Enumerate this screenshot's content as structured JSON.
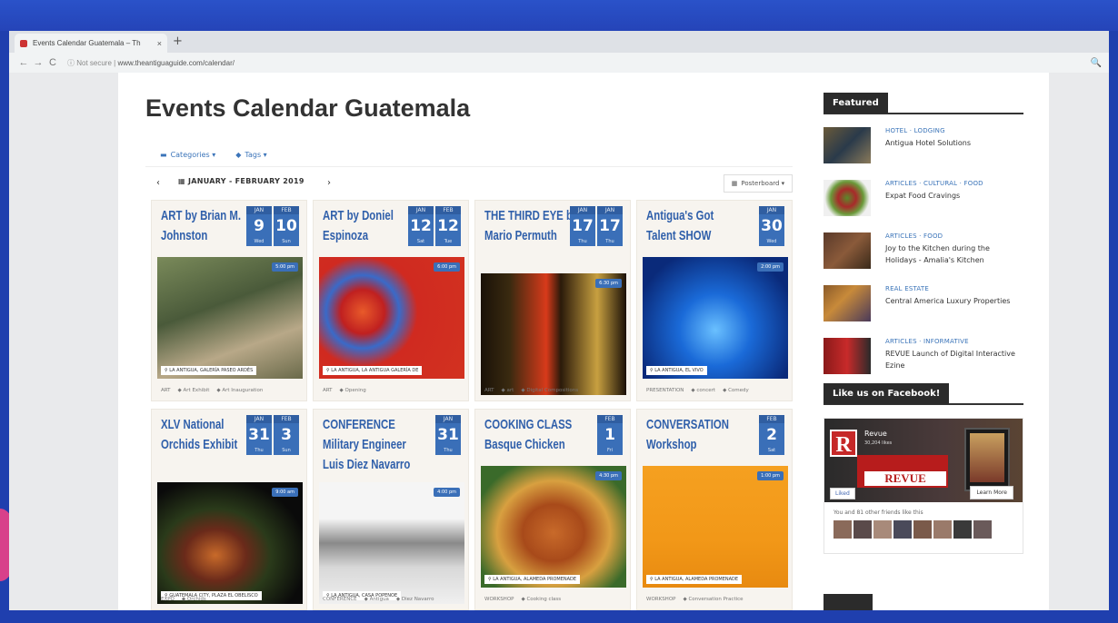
{
  "browser": {
    "tab_title": "Events Calendar Guatemala – Th",
    "tab_close": "×",
    "new_tab": "+",
    "back": "←",
    "forward": "→",
    "reload": "C",
    "security": "ⓘ Not secure",
    "url": "www.theantiguaguide.com/calendar/",
    "zoom": "🔍"
  },
  "page": {
    "title": "Events Calendar Guatemala",
    "filters": {
      "categories": "Categories ▾",
      "tags": "Tags ▾"
    },
    "toolbar": {
      "prev": "‹",
      "next": "›",
      "date_range": "JANUARY - FEBRUARY 2019",
      "layout": "Posterboard ▾"
    }
  },
  "events": [
    {
      "title": "ART by Brian M. Johnston",
      "dates": [
        {
          "month": "JAN",
          "day": "9",
          "weekday": "Wed"
        },
        {
          "month": "FEB",
          "day": "10",
          "weekday": "Sun"
        }
      ],
      "time": "5:00 pm",
      "location": "LA ANTIGUA, GALERÍA PASEO ARDÉS",
      "tags": [
        "ART",
        "Art Exhibit",
        "Art Inauguration"
      ],
      "bg": "linear-gradient(160deg,#7a8a5a,#4a5a3a 40%,#b8a888 70%,#6a6a4a)"
    },
    {
      "title": "ART by Doniel Espinoza",
      "dates": [
        {
          "month": "JAN",
          "day": "12",
          "weekday": "Sat"
        },
        {
          "month": "FEB",
          "day": "12",
          "weekday": "Tue"
        }
      ],
      "time": "6:00 pm",
      "location": "LA ANTIGUA, LA ANTIGUA GALERÍA DE",
      "tags": [
        "ART",
        "Opening"
      ],
      "bg": "radial-gradient(circle at 30% 45%,#e85a2a 0,#c02020 18%,#3a6ac8 30%,#d02a20 45%,#d23220 100%)"
    },
    {
      "title": "THE THIRD EYE by Mario Permuth",
      "dates": [
        {
          "month": "JAN",
          "day": "17",
          "weekday": "Thu"
        },
        {
          "month": "JAN",
          "day": "17",
          "weekday": "Thu"
        }
      ],
      "time": "6:30 pm",
      "location": "",
      "tags": [
        "ART",
        "art",
        "Digital Compositions"
      ],
      "bg": "linear-gradient(90deg,#1a1208,#3a2a10 20%,#d83a1a 45%,#2a1a0a 55%,#c8a040 80%,#1a1008)"
    },
    {
      "title": "Antigua's Got Talent SHOW",
      "dates": [
        {
          "month": "JAN",
          "day": "30",
          "weekday": "Wed"
        }
      ],
      "time": "2:00 pm",
      "location": "LA ANTIGUA, EL VIVO",
      "tags": [
        "PRESENTATION",
        "concert",
        "Comedy"
      ],
      "bg": "radial-gradient(ellipse at 50% 60%,#6ac0ff 0,#1a6ad8 35%,#0a2a7a 80%)"
    },
    {
      "title": "XLV National Orchids Exhibit",
      "dates": [
        {
          "month": "JAN",
          "day": "31",
          "weekday": "Thu"
        },
        {
          "month": "FEB",
          "day": "3",
          "weekday": "Sun"
        }
      ],
      "time": "9:00 am",
      "location": "GUATEMALA CITY, PLAZA EL OBELISCO",
      "tags": [
        "EXPO",
        "Orchids"
      ],
      "bg": "radial-gradient(ellipse at 40% 60%,#c86a2a 0,#6a2a1a 25%,#2a3a1a 45%,#0a0a0a 75%)"
    },
    {
      "title": "CONFERENCE Military Engineer Luis Diez Navarro",
      "dates": [
        {
          "month": "JAN",
          "day": "31",
          "weekday": "Thu"
        }
      ],
      "time": "4:00 pm",
      "location": "LA ANTIGUA, CASA POPENOE",
      "tags": [
        "CONFERENCE",
        "Antigua",
        "Diez Navarro"
      ],
      "bg": "linear-gradient(#f5f5f5,#f5f5f5 30%,#8a8a8a 50%,#d8d8d8 70%,#f0f0f0)"
    },
    {
      "title": "COOKING CLASS Basque Chicken",
      "dates": [
        {
          "month": "FEB",
          "day": "1",
          "weekday": "Fri"
        }
      ],
      "time": "4:30 pm",
      "location": "LA ANTIGUA, ALAMEDA PROMENADE",
      "tags": [
        "WORKSHOP",
        "Cooking class"
      ],
      "bg": "radial-gradient(ellipse at 50% 55%,#c86a2a 0,#a84a1a 30%,#d8a040 55%,#3a6a2a 80%)"
    },
    {
      "title": "CONVERSATION Workshop",
      "dates": [
        {
          "month": "FEB",
          "day": "2",
          "weekday": "Sat"
        }
      ],
      "time": "1:00 pm",
      "location": "LA ANTIGUA, ALAMEDA PROMENADE",
      "tags": [
        "WORKSHOP",
        "Conversation Practice"
      ],
      "bg": "linear-gradient(#f5a020,#f29818 60%,#e88a10)"
    }
  ],
  "sidebar": {
    "featured_label": "Featured",
    "featured": [
      {
        "category": "HOTEL · LODGING",
        "title": "Antigua Hotel Solutions",
        "thumb": "linear-gradient(135deg,#6a5a3a,#2a3a4a 50%,#8a7a5a)"
      },
      {
        "category": "ARTICLES · CULTURAL · FOOD",
        "title": "Expat Food Cravings",
        "thumb": "radial-gradient(circle at 50% 50%,#5a8a2a 0,#a82a2a 30%,#6a9a3a 55%,#f0f0f0 75%)"
      },
      {
        "category": "ARTICLES · FOOD",
        "title": "Joy to the Kitchen during the Holidays - Amalia's Kitchen",
        "thumb": "linear-gradient(135deg,#5a3a2a,#8a5a3a 50%,#3a2a1a)"
      },
      {
        "category": "REAL ESTATE",
        "title": "Central America Luxury Properties",
        "thumb": "linear-gradient(135deg,#8a5a2a,#c88a3a 40%,#4a3a5a)"
      },
      {
        "category": "ARTICLES · INFORMATIVE",
        "title": "REVUE Launch of Digital Interactive Ezine",
        "thumb": "linear-gradient(90deg,#8a1a1a,#c82a2a 50%,#2a2a2a)"
      }
    ],
    "facebook_label": "Like us on Facebook!",
    "facebook": {
      "logo": "R",
      "name": "Revue",
      "sub": "30,204 likes",
      "banner": "REVUE",
      "liked": "Liked",
      "learn": "Learn More",
      "friends": "You and 81 other friends like this"
    }
  }
}
